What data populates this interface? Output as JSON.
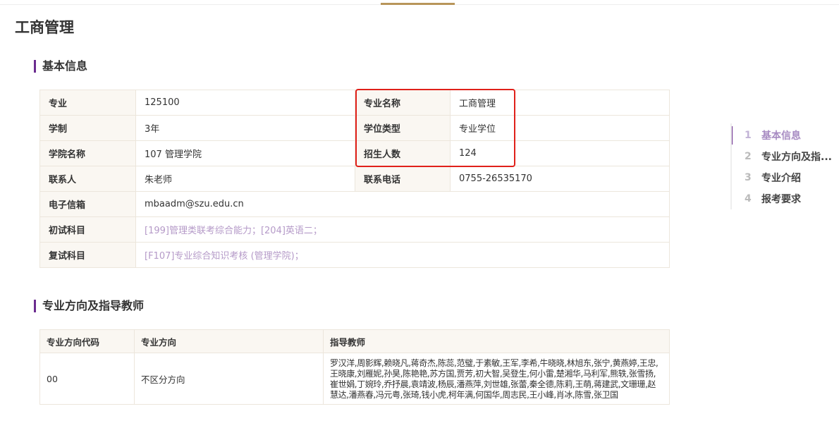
{
  "page_title": "工商管理",
  "sections": {
    "basic_info": "基本信息",
    "directions": "专业方向及指导教师"
  },
  "info": {
    "major_label": "专业",
    "major_value": "125100",
    "major_name_label": "专业名称",
    "major_name_value": "工商管理",
    "duration_label": "学制",
    "duration_value": "3年",
    "degree_type_label": "学位类型",
    "degree_type_value": "专业学位",
    "college_label": "学院名称",
    "college_value": "107 管理学院",
    "enrollment_label": "招生人数",
    "enrollment_value": "124",
    "contact_label": "联系人",
    "contact_value": "朱老师",
    "phone_label": "联系电话",
    "phone_value": "0755-26535170",
    "email_label": "电子信箱",
    "email_value": "mbaadm@szu.edu.cn",
    "first_exam_label": "初试科目",
    "first_exam_value": "[199]管理类联考综合能力；[204]英语二；",
    "retest_label": "复试科目",
    "retest_value": "[F107]专业综合知识考核 (管理学院)；"
  },
  "directions_table": {
    "headers": [
      "专业方向代码",
      "专业方向",
      "指导教师"
    ],
    "rows": [
      {
        "code": "00",
        "direction": "不区分方向",
        "teachers": "罗汉洋,周影辉,赖晓凡,蒋奇杰,陈蕊,范璧,于素敏,王军,李希,牛晓晓,林旭东,张宁,黄燕婷,王忠,王晓康,刘雁妮,孙昊,陈艳艳,苏方国,贾芳,初大智,吴登生,何小雷,楚湘华,马利军,熊轶,张雪扬,崔世娟,丁婉玲,乔抒晨,袁靖波,杨辰,潘燕萍,刘世雄,张蕾,秦全德,陈莉,王萌,蒋建武,文珊珊,赵慧达,潘燕春,冯元粤,张琦,钱小虎,柯年满,何国华,周志民,王小峰,肖冰,陈雪,张卫国"
      }
    ]
  },
  "toc": [
    {
      "num": "1",
      "label": "基本信息",
      "active": true
    },
    {
      "num": "2",
      "label": "专业方向及指...",
      "active": false
    },
    {
      "num": "3",
      "label": "专业介绍",
      "active": false
    },
    {
      "num": "4",
      "label": "报考要求",
      "active": false
    }
  ],
  "colors": {
    "accent_purple": "#6b2c8f",
    "link_purple": "#b59ac8",
    "highlight_red": "#e0201a",
    "top_accent": "#b8955a"
  }
}
